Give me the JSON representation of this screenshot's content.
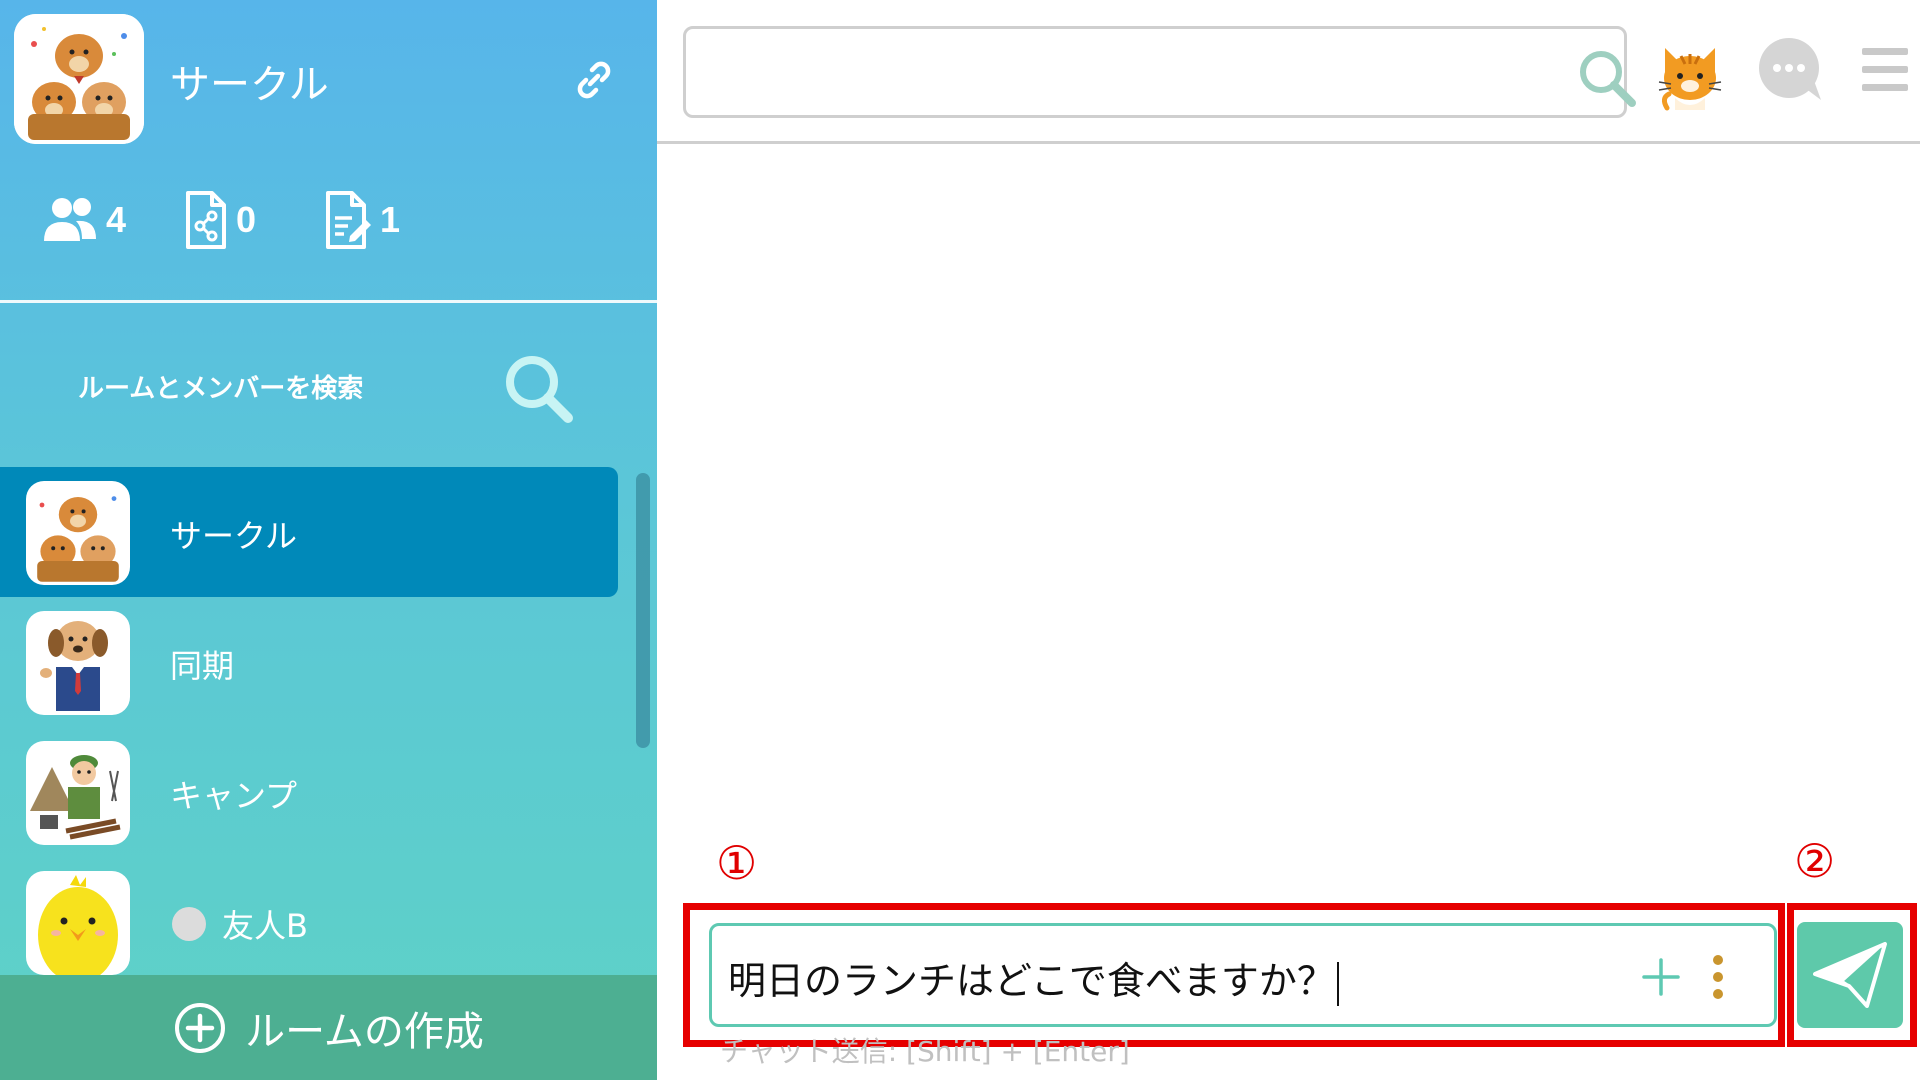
{
  "sidebar": {
    "circle": {
      "name": "サークル",
      "avatar_icon": "dogs-celebrating-icon",
      "link_icon": "link-icon"
    },
    "stats": [
      {
        "icon": "members-icon",
        "count": "4"
      },
      {
        "icon": "shared-file-icon",
        "count": "0"
      },
      {
        "icon": "note-edit-icon",
        "count": "1"
      }
    ],
    "room_search": {
      "label": "ルームとメンバーを検索",
      "icon": "search-icon"
    },
    "rooms": [
      {
        "name": "サークル",
        "avatar_icon": "dogs-celebrating-icon",
        "active": true
      },
      {
        "name": "同期",
        "avatar_icon": "dog-businessman-icon",
        "active": false
      },
      {
        "name": "キャンプ",
        "avatar_icon": "camper-icon",
        "active": false
      },
      {
        "name": "友人B",
        "avatar_icon": "chick-icon",
        "active": false,
        "status": "offline"
      }
    ],
    "create_room": {
      "label": "ルームの作成",
      "icon": "plus-circle-icon"
    }
  },
  "topbar": {
    "search": {
      "value": "",
      "placeholder": "",
      "icon": "search-icon"
    },
    "icons": [
      "cat-avatar-icon",
      "chat-bubble-icon",
      "hamburger-menu-icon"
    ]
  },
  "annotations": {
    "one": "①",
    "two": "②"
  },
  "composer": {
    "text": "明日のランチはどこで食べますか？",
    "hint": "チャット送信: [Shift] + [Enter]",
    "icons": [
      "plus-icon",
      "more-vertical-icon"
    ]
  },
  "send": {
    "icon": "paper-plane-icon"
  },
  "colors": {
    "sidebar_top": "#57b5ea",
    "sidebar_bottom": "#5ed2c6",
    "active_room": "#0089b9",
    "create_room": "#4daf92",
    "accent": "#5ec9aa",
    "annotation": "#e60000"
  }
}
